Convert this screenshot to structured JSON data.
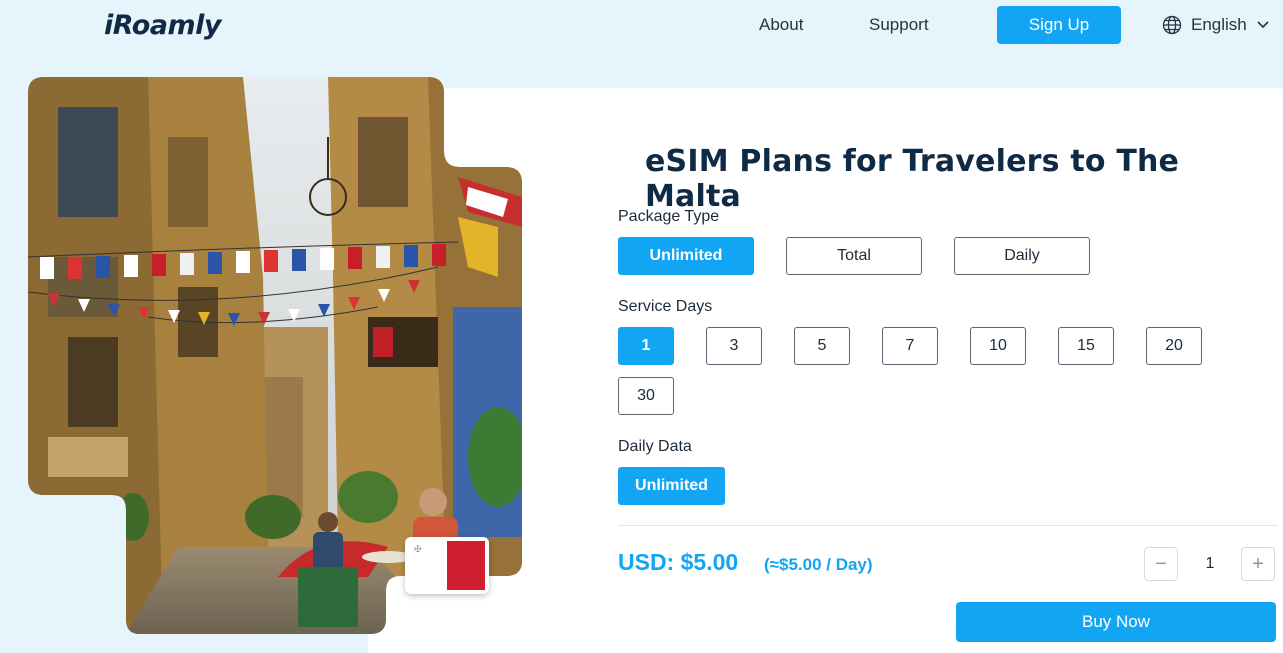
{
  "header": {
    "logo": "iRoamly",
    "nav": {
      "about": "About",
      "support": "Support"
    },
    "signup_label": "Sign Up",
    "language": "English"
  },
  "hero": {
    "title": "eSIM Plans for Travelers to The Malta",
    "flag_icon": "malta-flag-icon"
  },
  "package_type": {
    "label": "Package Type",
    "options": [
      "Unlimited",
      "Total",
      "Daily"
    ],
    "selected": "Unlimited"
  },
  "service_days": {
    "label": "Service Days",
    "options": [
      "1",
      "3",
      "5",
      "7",
      "10",
      "15",
      "20",
      "30"
    ],
    "selected": "1"
  },
  "daily_data": {
    "label": "Daily Data",
    "options": [
      "Unlimited"
    ],
    "selected": "Unlimited"
  },
  "pricing": {
    "price": "USD: $5.00",
    "per_day": "(≈$5.00 / Day)",
    "quantity": "1",
    "minus_label": "−",
    "plus_label": "+",
    "buy_label": "Buy Now"
  },
  "colors": {
    "accent": "#12a5f4",
    "page_bg": "#e6f4fc",
    "heading": "#0f2a44",
    "flag_red": "#cf1f2e"
  },
  "icons": {
    "language": "globe-icon",
    "language_dropdown": "chevron-down-icon"
  }
}
